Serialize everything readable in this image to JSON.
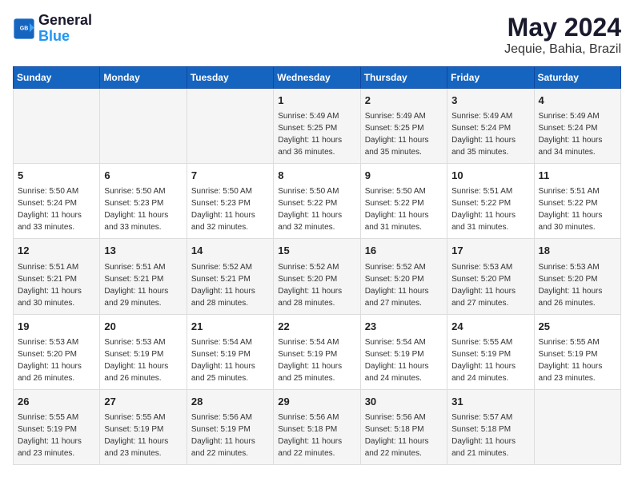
{
  "header": {
    "logo_line1": "General",
    "logo_line2": "Blue",
    "title": "May 2024",
    "subtitle": "Jequie, Bahia, Brazil"
  },
  "days_of_week": [
    "Sunday",
    "Monday",
    "Tuesday",
    "Wednesday",
    "Thursday",
    "Friday",
    "Saturday"
  ],
  "weeks": [
    [
      {
        "day": "",
        "info": ""
      },
      {
        "day": "",
        "info": ""
      },
      {
        "day": "",
        "info": ""
      },
      {
        "day": "1",
        "info": "Sunrise: 5:49 AM\nSunset: 5:25 PM\nDaylight: 11 hours and 36 minutes."
      },
      {
        "day": "2",
        "info": "Sunrise: 5:49 AM\nSunset: 5:25 PM\nDaylight: 11 hours and 35 minutes."
      },
      {
        "day": "3",
        "info": "Sunrise: 5:49 AM\nSunset: 5:24 PM\nDaylight: 11 hours and 35 minutes."
      },
      {
        "day": "4",
        "info": "Sunrise: 5:49 AM\nSunset: 5:24 PM\nDaylight: 11 hours and 34 minutes."
      }
    ],
    [
      {
        "day": "5",
        "info": "Sunrise: 5:50 AM\nSunset: 5:24 PM\nDaylight: 11 hours and 33 minutes."
      },
      {
        "day": "6",
        "info": "Sunrise: 5:50 AM\nSunset: 5:23 PM\nDaylight: 11 hours and 33 minutes."
      },
      {
        "day": "7",
        "info": "Sunrise: 5:50 AM\nSunset: 5:23 PM\nDaylight: 11 hours and 32 minutes."
      },
      {
        "day": "8",
        "info": "Sunrise: 5:50 AM\nSunset: 5:22 PM\nDaylight: 11 hours and 32 minutes."
      },
      {
        "day": "9",
        "info": "Sunrise: 5:50 AM\nSunset: 5:22 PM\nDaylight: 11 hours and 31 minutes."
      },
      {
        "day": "10",
        "info": "Sunrise: 5:51 AM\nSunset: 5:22 PM\nDaylight: 11 hours and 31 minutes."
      },
      {
        "day": "11",
        "info": "Sunrise: 5:51 AM\nSunset: 5:22 PM\nDaylight: 11 hours and 30 minutes."
      }
    ],
    [
      {
        "day": "12",
        "info": "Sunrise: 5:51 AM\nSunset: 5:21 PM\nDaylight: 11 hours and 30 minutes."
      },
      {
        "day": "13",
        "info": "Sunrise: 5:51 AM\nSunset: 5:21 PM\nDaylight: 11 hours and 29 minutes."
      },
      {
        "day": "14",
        "info": "Sunrise: 5:52 AM\nSunset: 5:21 PM\nDaylight: 11 hours and 28 minutes."
      },
      {
        "day": "15",
        "info": "Sunrise: 5:52 AM\nSunset: 5:20 PM\nDaylight: 11 hours and 28 minutes."
      },
      {
        "day": "16",
        "info": "Sunrise: 5:52 AM\nSunset: 5:20 PM\nDaylight: 11 hours and 27 minutes."
      },
      {
        "day": "17",
        "info": "Sunrise: 5:53 AM\nSunset: 5:20 PM\nDaylight: 11 hours and 27 minutes."
      },
      {
        "day": "18",
        "info": "Sunrise: 5:53 AM\nSunset: 5:20 PM\nDaylight: 11 hours and 26 minutes."
      }
    ],
    [
      {
        "day": "19",
        "info": "Sunrise: 5:53 AM\nSunset: 5:20 PM\nDaylight: 11 hours and 26 minutes."
      },
      {
        "day": "20",
        "info": "Sunrise: 5:53 AM\nSunset: 5:19 PM\nDaylight: 11 hours and 26 minutes."
      },
      {
        "day": "21",
        "info": "Sunrise: 5:54 AM\nSunset: 5:19 PM\nDaylight: 11 hours and 25 minutes."
      },
      {
        "day": "22",
        "info": "Sunrise: 5:54 AM\nSunset: 5:19 PM\nDaylight: 11 hours and 25 minutes."
      },
      {
        "day": "23",
        "info": "Sunrise: 5:54 AM\nSunset: 5:19 PM\nDaylight: 11 hours and 24 minutes."
      },
      {
        "day": "24",
        "info": "Sunrise: 5:55 AM\nSunset: 5:19 PM\nDaylight: 11 hours and 24 minutes."
      },
      {
        "day": "25",
        "info": "Sunrise: 5:55 AM\nSunset: 5:19 PM\nDaylight: 11 hours and 23 minutes."
      }
    ],
    [
      {
        "day": "26",
        "info": "Sunrise: 5:55 AM\nSunset: 5:19 PM\nDaylight: 11 hours and 23 minutes."
      },
      {
        "day": "27",
        "info": "Sunrise: 5:55 AM\nSunset: 5:19 PM\nDaylight: 11 hours and 23 minutes."
      },
      {
        "day": "28",
        "info": "Sunrise: 5:56 AM\nSunset: 5:19 PM\nDaylight: 11 hours and 22 minutes."
      },
      {
        "day": "29",
        "info": "Sunrise: 5:56 AM\nSunset: 5:18 PM\nDaylight: 11 hours and 22 minutes."
      },
      {
        "day": "30",
        "info": "Sunrise: 5:56 AM\nSunset: 5:18 PM\nDaylight: 11 hours and 22 minutes."
      },
      {
        "day": "31",
        "info": "Sunrise: 5:57 AM\nSunset: 5:18 PM\nDaylight: 11 hours and 21 minutes."
      },
      {
        "day": "",
        "info": ""
      }
    ]
  ]
}
